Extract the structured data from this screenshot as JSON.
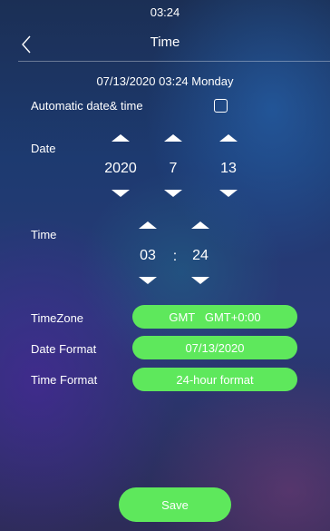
{
  "status_bar": {
    "time": "03:24"
  },
  "header": {
    "title": "Time"
  },
  "current_datetime": "07/13/2020 03:24 Monday",
  "automatic": {
    "label": "Automatic date& time",
    "checked": false
  },
  "date": {
    "label": "Date",
    "year": "2020",
    "month": "7",
    "day": "13"
  },
  "time": {
    "label": "Time",
    "hour": "03",
    "separator": ":",
    "minute": "24"
  },
  "settings": {
    "timezone_label": "TimeZone",
    "timezone_value": "GMT   GMT+0:00",
    "date_format_label": "Date Format",
    "date_format_value": "07/13/2020",
    "time_format_label": "Time Format",
    "time_format_value": "24-hour format"
  },
  "save_label": "Save",
  "colors": {
    "accent_green": "#5ee85c"
  },
  "icons": {
    "back": "chevron-left-icon",
    "increment": "caret-up-icon",
    "decrement": "caret-down-icon"
  }
}
